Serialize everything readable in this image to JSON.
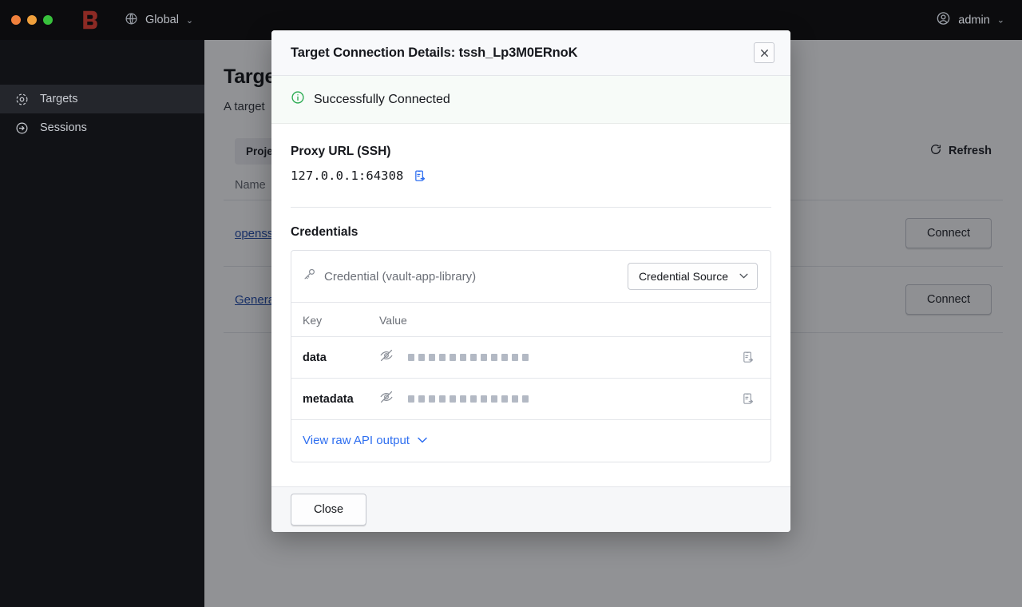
{
  "titlebar": {
    "logo_icon": "boundary-logo",
    "scope": {
      "label": "Global",
      "icon": "globe-icon",
      "chevron": "⌄"
    },
    "user": {
      "label": "admin",
      "icon": "user-circle-icon",
      "chevron": "⌄"
    }
  },
  "sidebar": {
    "items": [
      {
        "label": "Targets",
        "icon": "target-icon",
        "active": true
      },
      {
        "label": "Sessions",
        "icon": "session-arrow-icon",
        "active": false
      }
    ]
  },
  "main": {
    "title": "Targets",
    "description": "A target",
    "project_chip": "Project",
    "refresh_label": "Refresh",
    "refresh_icon": "refresh-icon",
    "columns": [
      "Name",
      ""
    ],
    "rows": [
      {
        "name": "openssh",
        "action": "Connect"
      },
      {
        "name": "General",
        "action": "Connect"
      }
    ]
  },
  "modal": {
    "title": "Target Connection Details: tssh_Lp3M0ERnoK",
    "close_icon": "close-icon",
    "banner": {
      "icon": "info-circle-icon",
      "text": "Successfully Connected",
      "color": "#2bab52"
    },
    "proxy": {
      "label": "Proxy URL (SSH)",
      "value": "127.0.0.1:64308",
      "copy_icon": "copy-icon",
      "copy_color": "#2f6ff0"
    },
    "credentials": {
      "heading": "Credentials",
      "source_icon": "key-icon",
      "source_name": "Credential (vault-app-library)",
      "source_select_label": "Credential Source",
      "source_select_chevron": "⌄",
      "table": {
        "columns": [
          "Key",
          "Value"
        ],
        "rows": [
          {
            "key": "data",
            "masked": true,
            "mask_count": 12,
            "reveal_icon": "eye-off-icon",
            "copy_icon": "copy-icon"
          },
          {
            "key": "metadata",
            "masked": true,
            "mask_count": 12,
            "reveal_icon": "eye-off-icon",
            "copy_icon": "copy-icon"
          }
        ]
      },
      "raw_link": {
        "label": "View raw API output",
        "chevron": "⌄",
        "color": "#2f6ff0"
      }
    },
    "footer": {
      "close_label": "Close"
    }
  }
}
